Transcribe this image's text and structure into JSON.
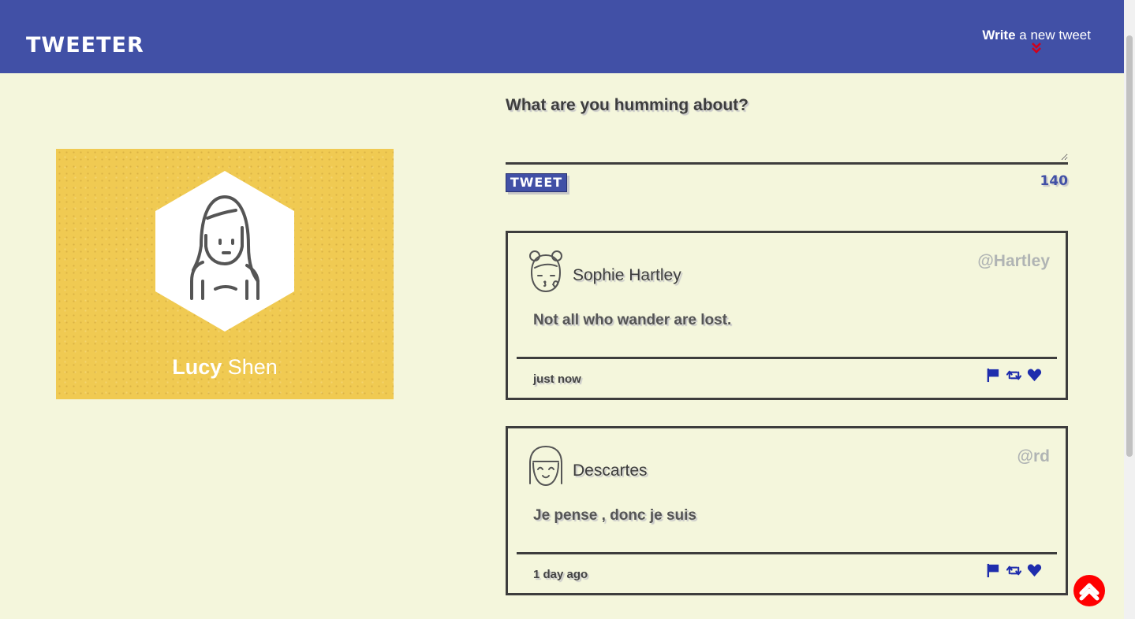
{
  "header": {
    "brand": "TWEETER",
    "compose_bold": "Write",
    "compose_rest": " a new tweet",
    "compose_icon": "double-chevron-down-icon",
    "accent_color": "#4150a6",
    "alert_color": "#ff0000"
  },
  "profile": {
    "first_name": "Lucy",
    "last_name": " Shen",
    "avatar_icon": "girl-avatar-icon"
  },
  "composer": {
    "title": "What are you humming about?",
    "text_value": "",
    "button_label": "TWEET",
    "counter": "140"
  },
  "tweets": [
    {
      "name": "Sophie Hartley",
      "handle": "@Hartley",
      "content": "Not all who wander are lost.",
      "time": "just now",
      "avatar_icon": "girl-buns-kiss-avatar-icon"
    },
    {
      "name": "Descartes",
      "handle": "@rd",
      "content": "Je pense , donc je suis",
      "time": "1 day ago",
      "avatar_icon": "smiling-girl-avatar-icon"
    }
  ],
  "actions": [
    "flag-icon",
    "retweet-icon",
    "heart-icon"
  ],
  "scroll_top_icon": "chevron-up-icon"
}
